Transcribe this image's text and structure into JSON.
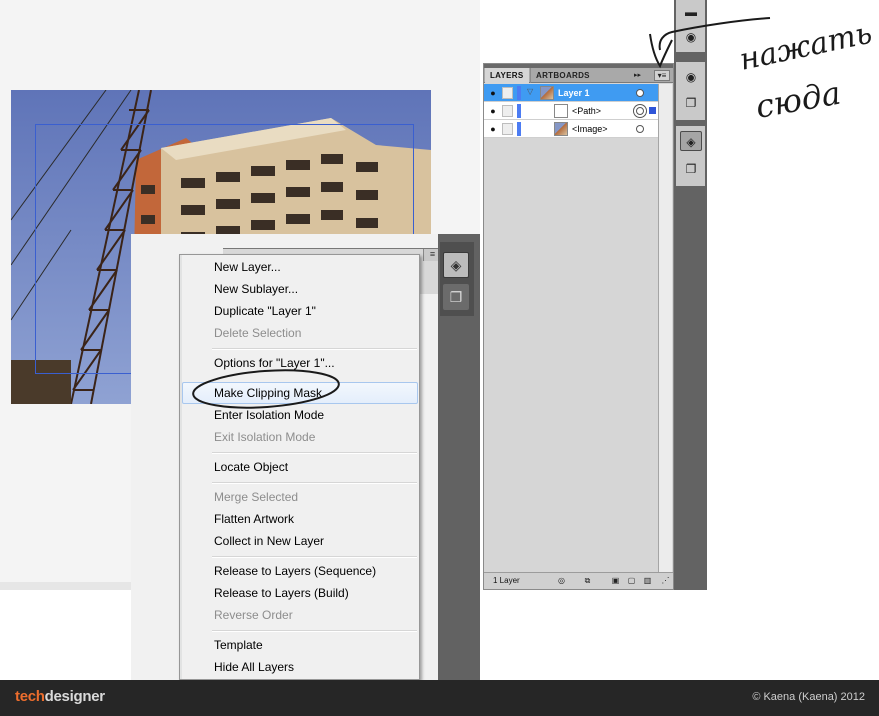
{
  "layers_panel": {
    "tabs": [
      "LAYERS",
      "ARTBOARDS"
    ],
    "forward_glyph": "▸▸",
    "menu_glyph": "▾≡",
    "rows": [
      {
        "name": "Layer 1",
        "active": true
      },
      {
        "name": "<Path>",
        "active": false
      },
      {
        "name": "<Image>",
        "active": false
      }
    ],
    "count_label": "1 Layer"
  },
  "context_menu": {
    "items": [
      {
        "label": "New Layer...",
        "disabled": false
      },
      {
        "label": "New Sublayer...",
        "disabled": false
      },
      {
        "label": "Duplicate \"Layer 1\"",
        "disabled": false
      },
      {
        "label": "Delete Selection",
        "disabled": true
      },
      {
        "label": "Options for \"Layer 1\"...",
        "disabled": false
      },
      {
        "label": "Make Clipping Mask",
        "disabled": false,
        "highlighted": true
      },
      {
        "label": "Enter Isolation Mode",
        "disabled": false
      },
      {
        "label": "Exit Isolation Mode",
        "disabled": true
      },
      {
        "label": "Locate Object",
        "disabled": false
      },
      {
        "label": "Merge Selected",
        "disabled": true
      },
      {
        "label": "Flatten Artwork",
        "disabled": false
      },
      {
        "label": "Collect in New Layer",
        "disabled": false
      },
      {
        "label": "Release to Layers (Sequence)",
        "disabled": false
      },
      {
        "label": "Release to Layers (Build)",
        "disabled": false
      },
      {
        "label": "Reverse Order",
        "disabled": true
      },
      {
        "label": "Template",
        "disabled": false
      },
      {
        "label": "Hide All Layers",
        "disabled": false
      }
    ]
  },
  "annotation": {
    "line1": "нажать",
    "line2": "сюда"
  },
  "footer": {
    "logo_part1": "tech",
    "logo_part2": "designer",
    "copyright": "© Kaena (Kaena) 2012"
  },
  "colors": {
    "accent_blue": "#3f9bf2",
    "logo_orange": "#ec6d2d",
    "footer_bg": "#262626",
    "menu_highlight_border": "#a8c7ee"
  },
  "icons": {
    "eye": "eye-icon",
    "target": "target-circle-icon",
    "layers_dock": "layers-icon",
    "artboards_dock": "artboards-icon",
    "new_layer": "new-layer-icon",
    "delete": "trash-icon"
  }
}
